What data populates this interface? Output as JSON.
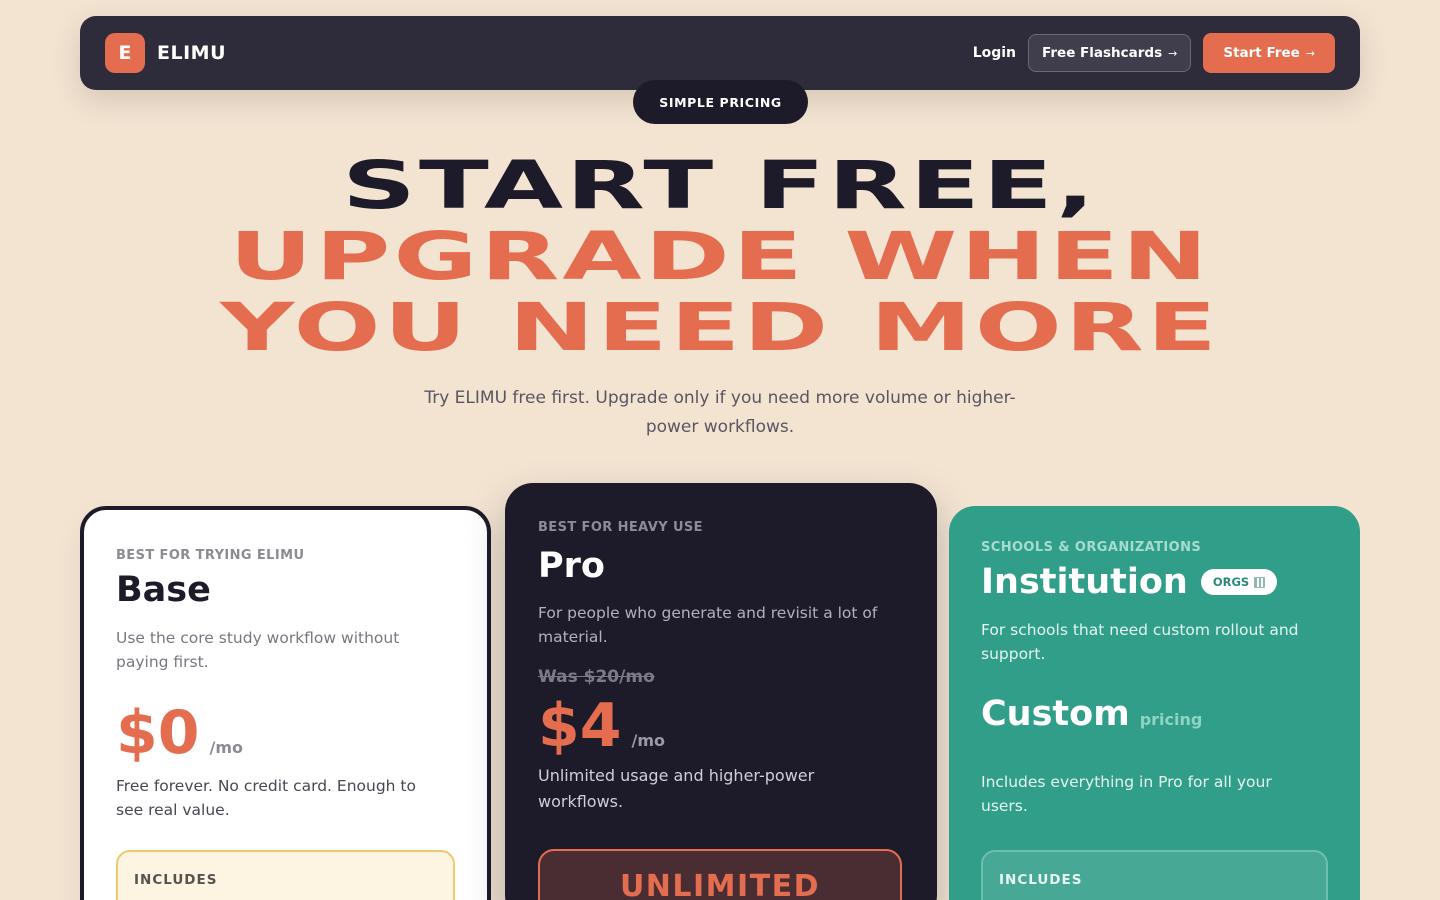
{
  "nav": {
    "logo_mark": "E",
    "logo_text": "ELIMU",
    "login": "Login",
    "free_flashcards": "Free Flashcards",
    "start_free": "Start Free",
    "arrow": "→"
  },
  "badge": "SIMPLE PRICING",
  "hero": {
    "line1": "START FREE,",
    "line2": "UPGRADE WHEN",
    "line3": "YOU NEED MORE"
  },
  "subtitle": "Try ELIMU free first. Upgrade only if you need more volume or higher-power workflows.",
  "plans": {
    "base": {
      "eyebrow": "BEST FOR TRYING ELIMU",
      "name": "Base",
      "desc": "Use the core study workflow without paying first.",
      "price": "$0",
      "per": "/mo",
      "note": "Free forever. No credit card. Enough to see real value.",
      "includes": "INCLUDES"
    },
    "pro": {
      "eyebrow": "BEST FOR HEAVY USE",
      "name": "Pro",
      "desc": "For people who generate and revisit a lot of material.",
      "was": "Was $20/mo",
      "price": "$4",
      "per": "/mo",
      "note": "Unlimited usage and higher-power workflows.",
      "highlight": "UNLIMITED"
    },
    "institution": {
      "eyebrow": "SCHOOLS & ORGANIZATIONS",
      "name": "Institution",
      "tag": "ORGS",
      "desc": "For schools that need custom rollout and support.",
      "price": "Custom",
      "per": "pricing",
      "note": "Includes everything in Pro for all your users.",
      "includes": "INCLUDES"
    }
  },
  "colors": {
    "background": "#f3e4d2",
    "accent": "#e46d4f",
    "dark": "#1d1b2a",
    "teal": "#319e8a"
  }
}
